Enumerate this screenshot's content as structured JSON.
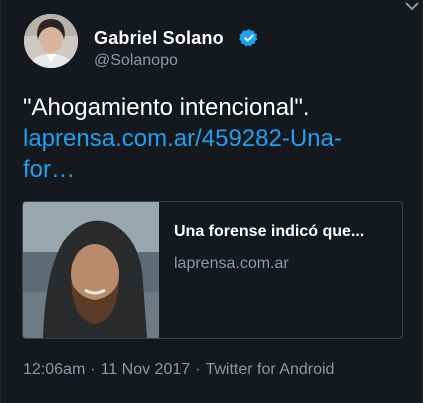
{
  "user": {
    "display_name": "Gabriel Solano",
    "handle": "@Solanopo"
  },
  "tweet": {
    "text": "\"Ahogamiento intencional\".",
    "link_line1": "laprensa.com.ar/459282-Una-",
    "link_line2": "for…"
  },
  "preview": {
    "title": "Una forense indicó que...",
    "domain": "laprensa.com.ar"
  },
  "meta": {
    "time": "12:06am",
    "separator": "·",
    "date": "11 Nov 2017",
    "source": "Twitter for Android"
  },
  "colors": {
    "background": "#15181c",
    "link": "#1da1f2",
    "muted": "#8899a6",
    "verified": "#1da1f2"
  }
}
